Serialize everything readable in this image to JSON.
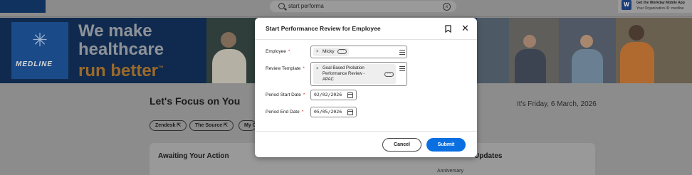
{
  "header": {
    "search_value": "start performa",
    "app_promo_title": "Get the Workday Mobile App",
    "app_promo_subtitle": "Your Organization ID: medline",
    "app_promo_icon_letter": "W"
  },
  "banner": {
    "brand": "MEDLINE",
    "slogan_line1": "We make",
    "slogan_line2": "healthcare",
    "slogan_line3": "run better",
    "trademark": "™"
  },
  "page": {
    "title": "Let's Focus on You",
    "date_text": "It's Friday, 6 March, 2026",
    "quick_links": [
      {
        "label": "Zendesk"
      },
      {
        "label": "The Source"
      },
      {
        "label": "My C"
      }
    ],
    "awaiting_title": "Awaiting Your Action",
    "updates_title": "Updates",
    "updates_first_row": "Anniversary"
  },
  "modal": {
    "title": "Start Performance Review for Employee",
    "employee_label": "Employee",
    "employee_value": "Micky",
    "template_label": "Review Template",
    "template_value_line1": "Goal Based Probation",
    "template_value_line2": "Performance Review -",
    "template_value_line3": "APAC",
    "start_label": "Period Start Date",
    "start_value": "02/02/2026",
    "end_label": "Period End Date",
    "end_value": "05/05/2026",
    "required_marker": "*",
    "cancel_label": "Cancel",
    "submit_label": "Submit"
  },
  "colors": {
    "submit_button": "#0a6fe0",
    "required_asterisk": "#d0291f",
    "banner_bg": "#0f2a4e"
  },
  "icons": [
    "search-icon",
    "clear-icon",
    "bookmark-icon",
    "close-icon",
    "menu-icon",
    "more-icon",
    "calendar-icon",
    "external-link-icon",
    "medline-star-icon"
  ]
}
